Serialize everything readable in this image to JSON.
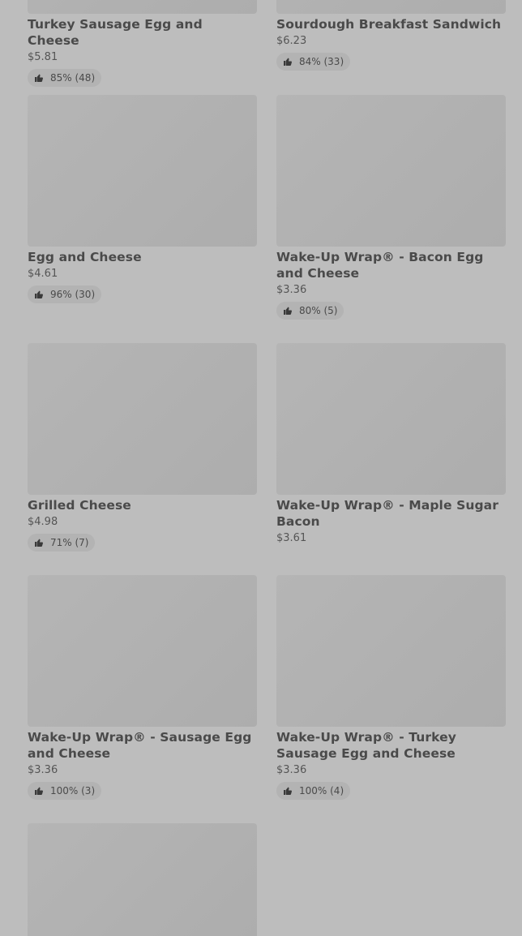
{
  "items": [
    {
      "name": "Turkey Sausage Egg and Cheese",
      "price": "$5.81",
      "rating": "85% (48)"
    },
    {
      "name": "Sourdough Breakfast Sandwich",
      "price": "$6.23",
      "rating": "84% (33)"
    },
    {
      "name": "Egg and Cheese",
      "price": "$4.61",
      "rating": "96% (30)"
    },
    {
      "name": "Wake-Up Wrap® - Bacon Egg and Cheese",
      "price": "$3.36",
      "rating": "80% (5)"
    },
    {
      "name": "Grilled Cheese",
      "price": "$4.98",
      "rating": "71% (7)"
    },
    {
      "name": "Wake-Up Wrap® - Maple Sugar Bacon",
      "price": "$3.61",
      "rating": ""
    },
    {
      "name": "Wake-Up Wrap® - Sausage Egg and Cheese",
      "price": "$3.36",
      "rating": "100% (3)"
    },
    {
      "name": "Wake-Up Wrap® - Turkey Sausage Egg and Cheese",
      "price": "$3.36",
      "rating": "100% (4)"
    },
    {
      "name": "",
      "price": "",
      "rating": ""
    }
  ],
  "icons": {
    "rating": "thumbs-up-icon"
  }
}
